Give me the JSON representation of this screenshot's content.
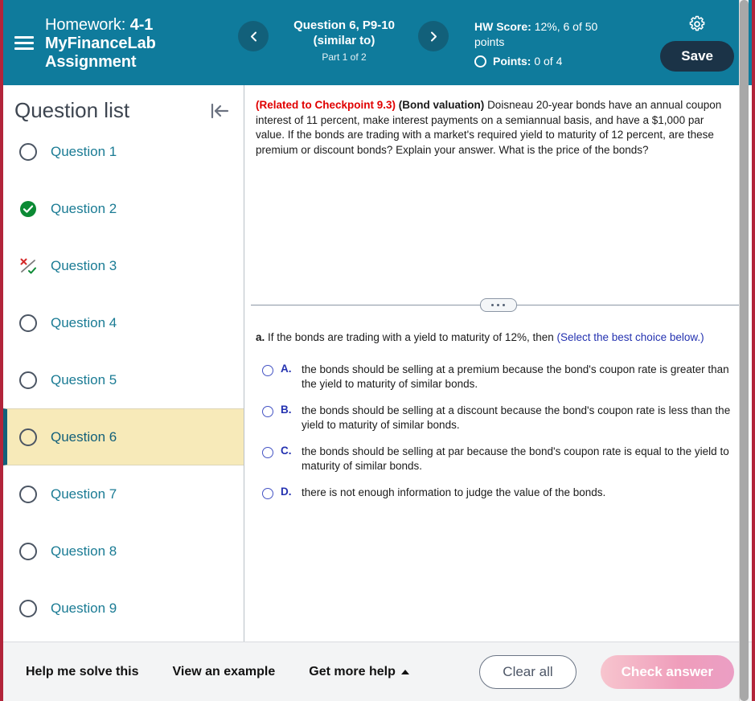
{
  "header": {
    "menu_icon": "hamburger-icon",
    "homework_label": "Homework:",
    "homework_title": "4-1 MyFinanceLab Assignment",
    "prev_icon": "chevron-left-icon",
    "next_icon": "chevron-right-icon",
    "question_title": "Question 6, P9-10 (similar to)",
    "question_part": "Part 1 of 2",
    "hw_score_label": "HW Score:",
    "hw_score_value": "12%, 6 of 50 points",
    "points_label": "Points:",
    "points_value": "0 of 4",
    "settings_icon": "gear-icon",
    "save_label": "Save",
    "bg_color": "#0f7b9c",
    "save_bg_color": "#1b3347"
  },
  "sidebar": {
    "title": "Question list",
    "collapse_icon": "collapse-left-icon",
    "items": [
      {
        "label": "Question 1",
        "status": "unanswered"
      },
      {
        "label": "Question 2",
        "status": "correct"
      },
      {
        "label": "Question 3",
        "status": "partial"
      },
      {
        "label": "Question 4",
        "status": "unanswered"
      },
      {
        "label": "Question 5",
        "status": "unanswered"
      },
      {
        "label": "Question 6",
        "status": "unanswered",
        "selected": true
      },
      {
        "label": "Question 7",
        "status": "unanswered"
      },
      {
        "label": "Question 8",
        "status": "unanswered"
      },
      {
        "label": "Question 9",
        "status": "unanswered"
      }
    ],
    "selected_bg_color": "#f7eab9",
    "link_color": "#1a7b94"
  },
  "question": {
    "checkpoint": "(Related to Checkpoint 9.3)",
    "topic": "(Bond valuation)",
    "body": "Doisneau 20-year bonds have an annual coupon interest of 11 percent, make interest payments on a semiannual basis, and have a $1,000 par value.  If the bonds are trading with a market's required yield to maturity of 12 percent, are these premium or discount bonds?  Explain your answer.  What is the price of the bonds?",
    "checkpoint_color": "#e00000"
  },
  "splitter": {
    "handle_icon": "drag-handle-dots-icon"
  },
  "answer": {
    "part_letter": "a.",
    "part_prompt": "If the bonds are trading with a yield to maturity of 12%, then",
    "select_hint": "(Select the best choice below.)",
    "choices": [
      {
        "letter": "A.",
        "text": "the bonds should be selling at a premium because the bond's coupon rate is greater than the yield to maturity of similar bonds."
      },
      {
        "letter": "B.",
        "text": "the bonds should be selling at a discount because the bond's coupon rate is less than the yield to maturity of similar bonds."
      },
      {
        "letter": "C.",
        "text": "the bonds should be selling at par because the bond's coupon rate is equal to the yield to maturity of similar bonds."
      },
      {
        "letter": "D.",
        "text": "there is not enough information to judge the value of the bonds."
      }
    ],
    "radio_color": "#4453c4"
  },
  "footer": {
    "help_me_solve": "Help me solve this",
    "view_example": "View an example",
    "get_more_help": "Get more help",
    "get_more_help_icon": "caret-up-icon",
    "clear_all": "Clear all",
    "check_answer": "Check answer"
  }
}
